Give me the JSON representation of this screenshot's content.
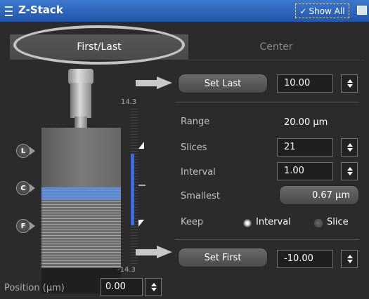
{
  "window": {
    "title": "Z-Stack",
    "show_all_label": "Show All",
    "show_all_check": "✓"
  },
  "tabs": [
    {
      "label": "First/Last"
    },
    {
      "label": "Center"
    }
  ],
  "scale": {
    "top": "14.3",
    "bottom": "-14.3"
  },
  "markers": {
    "last": "L",
    "center": "C",
    "first": "F"
  },
  "position": {
    "label": "Position (µm)",
    "value": "0.00"
  },
  "set_last": {
    "label": "Set Last",
    "value": "10.00"
  },
  "range": {
    "label": "Range",
    "value": "20.00 µm"
  },
  "slices": {
    "label": "Slices",
    "value": "21"
  },
  "interval": {
    "label": "Interval",
    "value": "1.00"
  },
  "smallest": {
    "label": "Smallest",
    "value": "0.67 µm"
  },
  "keep": {
    "label": "Keep",
    "option_interval": "Interval",
    "option_slice": "Slice"
  },
  "set_first": {
    "label": "Set First",
    "value": "-10.00"
  }
}
